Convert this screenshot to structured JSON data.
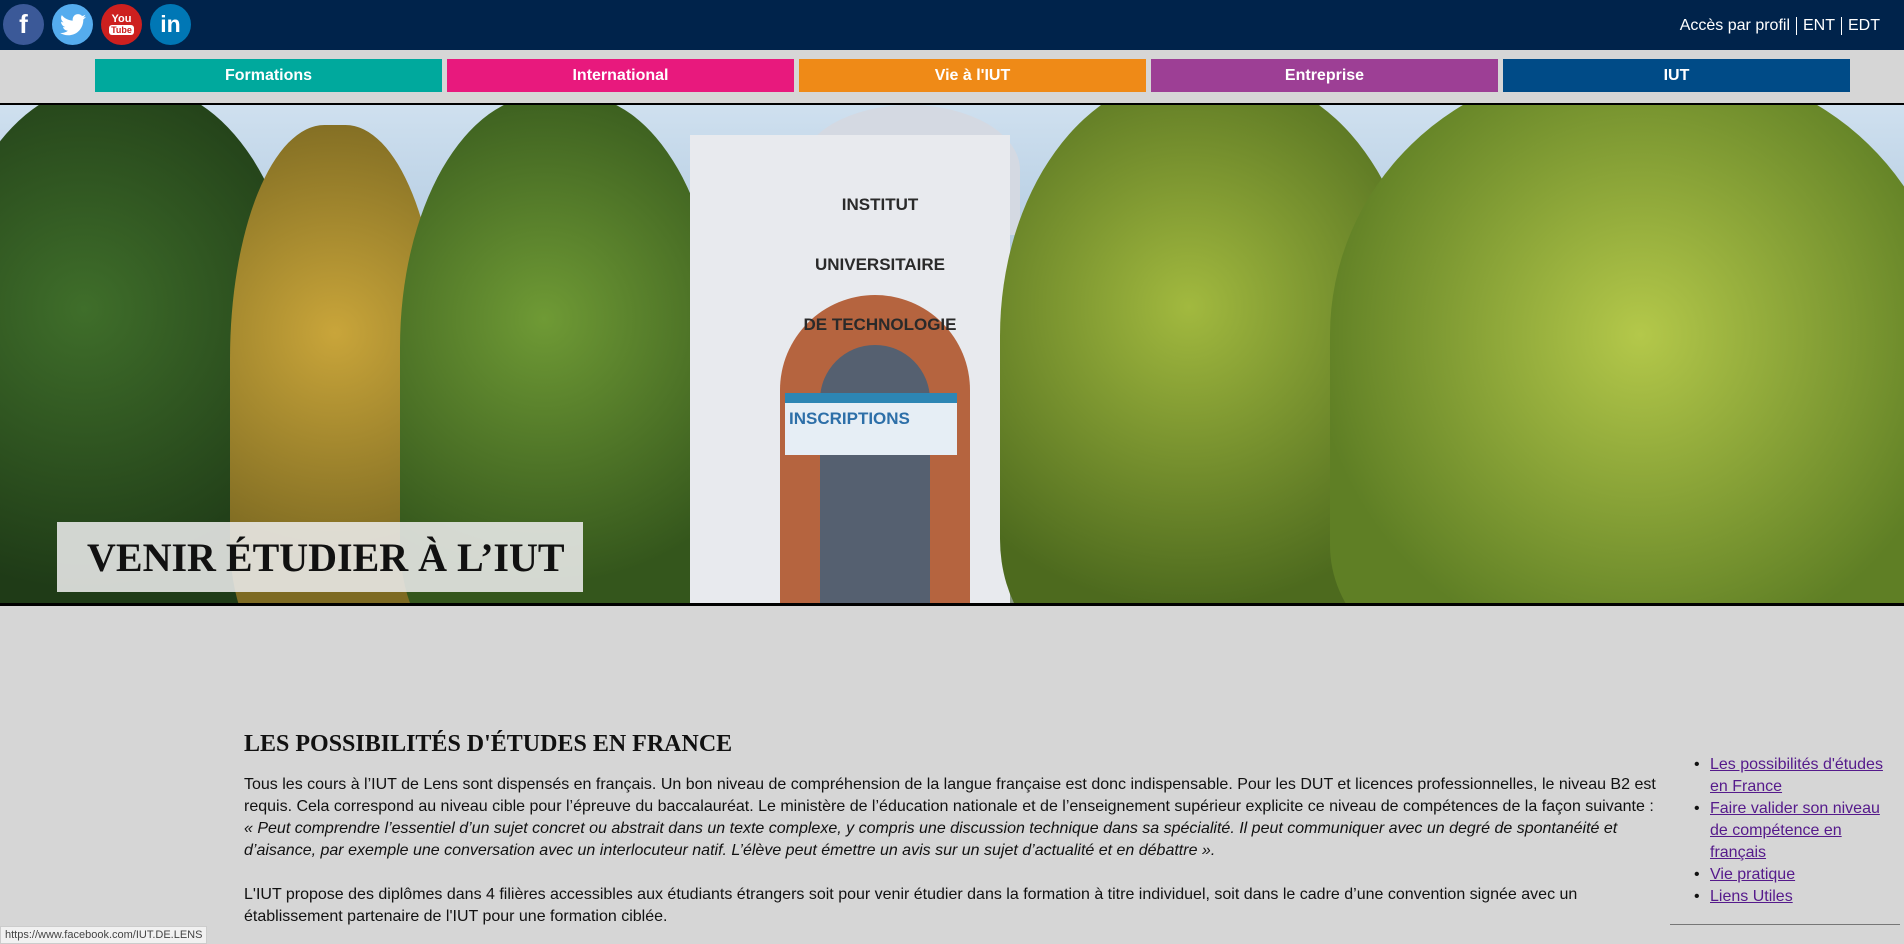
{
  "social": {
    "facebook_glyph": "f",
    "twitter_glyph": "🐦",
    "youtube_top": "You",
    "youtube_bottom": "Tube",
    "linkedin_glyph": "in"
  },
  "toplinks": [
    "Accès par profil",
    "ENT",
    "EDT"
  ],
  "nav": [
    {
      "label": "Formations",
      "color": "#00a99d"
    },
    {
      "label": "International",
      "color": "#e8197d"
    },
    {
      "label": "Vie à l'IUT",
      "color": "#ef8a17"
    },
    {
      "label": "Entreprise",
      "color": "#9d3f95"
    },
    {
      "label": "IUT",
      "color": "#004b87"
    }
  ],
  "hero": {
    "title": "VENIR ÉTUDIER À L’IUT",
    "building_line1": "INSTITUT UNIVERSITAIRE",
    "building_line2": "DE TECHNOLOGIE",
    "banner": "INSCRIPTIONS"
  },
  "content": {
    "heading": "LES POSSIBILITÉS D'ÉTUDES EN FRANCE",
    "p1": "Tous les cours à l’IUT de Lens sont dispensés en français. Un bon niveau de compréhension de la langue française est donc indispensable. Pour les DUT et licences professionnelles, le niveau B2 est requis. Cela correspond au niveau cible pour l’épreuve du baccalauréat. Le ministère de l’éducation nationale et de l’enseignement supérieur explicite ce niveau de compétences de la façon suivante :",
    "quote": "« Peut comprendre l’essentiel d’un sujet concret ou abstrait dans un texte complexe, y compris une discussion technique dans sa spécialité. Il peut communiquer avec un degré de spontanéité et d’aisance, par exemple une conversation avec un interlocuteur natif. L’élève peut émettre un avis sur un sujet d’actualité et en débattre ».",
    "p2": "L'IUT propose des diplômes dans 4 filières accessibles aux étudiants étrangers soit pour venir étudier dans la formation à titre individuel, soit dans le cadre d’une convention signée avec un établissement partenaire de l'IUT pour une formation ciblée."
  },
  "sidebar": [
    "Les possibilités d'études en France",
    "Faire valider son niveau de compétence en français",
    "Vie pratique",
    "Liens Utiles"
  ],
  "status_url": "https://www.facebook.com/IUT.DE.LENS"
}
